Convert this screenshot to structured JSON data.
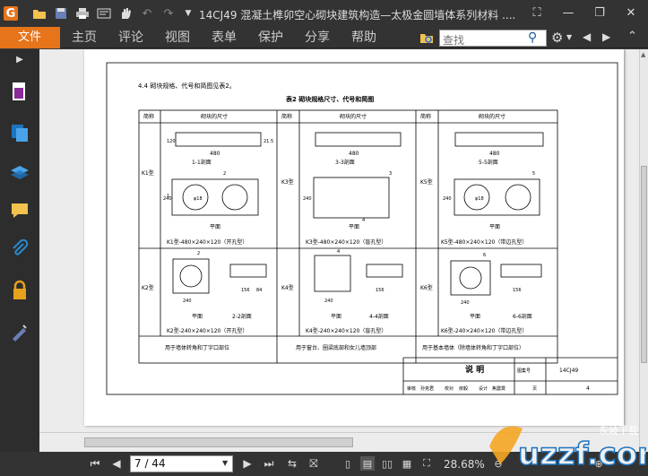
{
  "window": {
    "title": "14CJ49  混凝土榫卯空心砌块建筑构造—太极金圆墙体系列材料 ...."
  },
  "menu": {
    "file": "文件",
    "items": [
      "主页",
      "评论",
      "视图",
      "表单",
      "保护",
      "分享",
      "帮助"
    ]
  },
  "search": {
    "placeholder": "查找"
  },
  "nav": {
    "page": "7 / 44",
    "zoom": "28.68%"
  },
  "document": {
    "intro": "4.4 砌块规格、代号和简图见表2。",
    "table_title": "表2  砌块规格尺寸、代号和简图",
    "col_jc": "简称",
    "col_size": "砌块的尺寸",
    "row1": [
      "K1型",
      "K3型",
      "K5型"
    ],
    "row2": [
      "K2型",
      "K4型",
      "K6型"
    ],
    "cap1": [
      "K1型-480×240×120（开孔型）",
      "K3型-480×240×120（盲孔型）",
      "K5型-480×240×120（带边孔型）"
    ],
    "cap2": [
      "K2型-240×240×120（开孔型）",
      "K4型-240×240×120（盲孔型）",
      "K6型-240×240×120（带边孔型）"
    ],
    "use": [
      "用于墙体转角和丁字口部位",
      "用于窗台、圈梁底部和女儿墙顶部",
      "用于基本墙体（除墙体转角和丁字口部位）"
    ],
    "dims": {
      "d480": "480",
      "d240": "240",
      "d120": "120",
      "d21": "21.5",
      "d156": "156",
      "d84": "84",
      "d2": "2",
      "d3": "3",
      "d4": "4",
      "d5": "5",
      "d6": "6",
      "d1": "1",
      "phi": "φ18"
    },
    "labels": {
      "s11": "1-1剖面",
      "s33": "3-3剖面",
      "s55": "5-5剖面",
      "s22": "2-2剖面",
      "s44": "4-4剖面",
      "s66": "6-6剖面",
      "plan": "平面"
    },
    "titleblock": {
      "name": "说  明",
      "atlas_label": "图集号",
      "atlas": "14CJ49",
      "page_label": "页",
      "page": "4",
      "review": "审核",
      "reviewer": "孙克君",
      "check": "校对",
      "checker": "房毅",
      "design": "设计",
      "designer": "焦震霄"
    }
  },
  "watermark": {
    "text": "uzzf.com",
    "sub": "东坡下载"
  }
}
